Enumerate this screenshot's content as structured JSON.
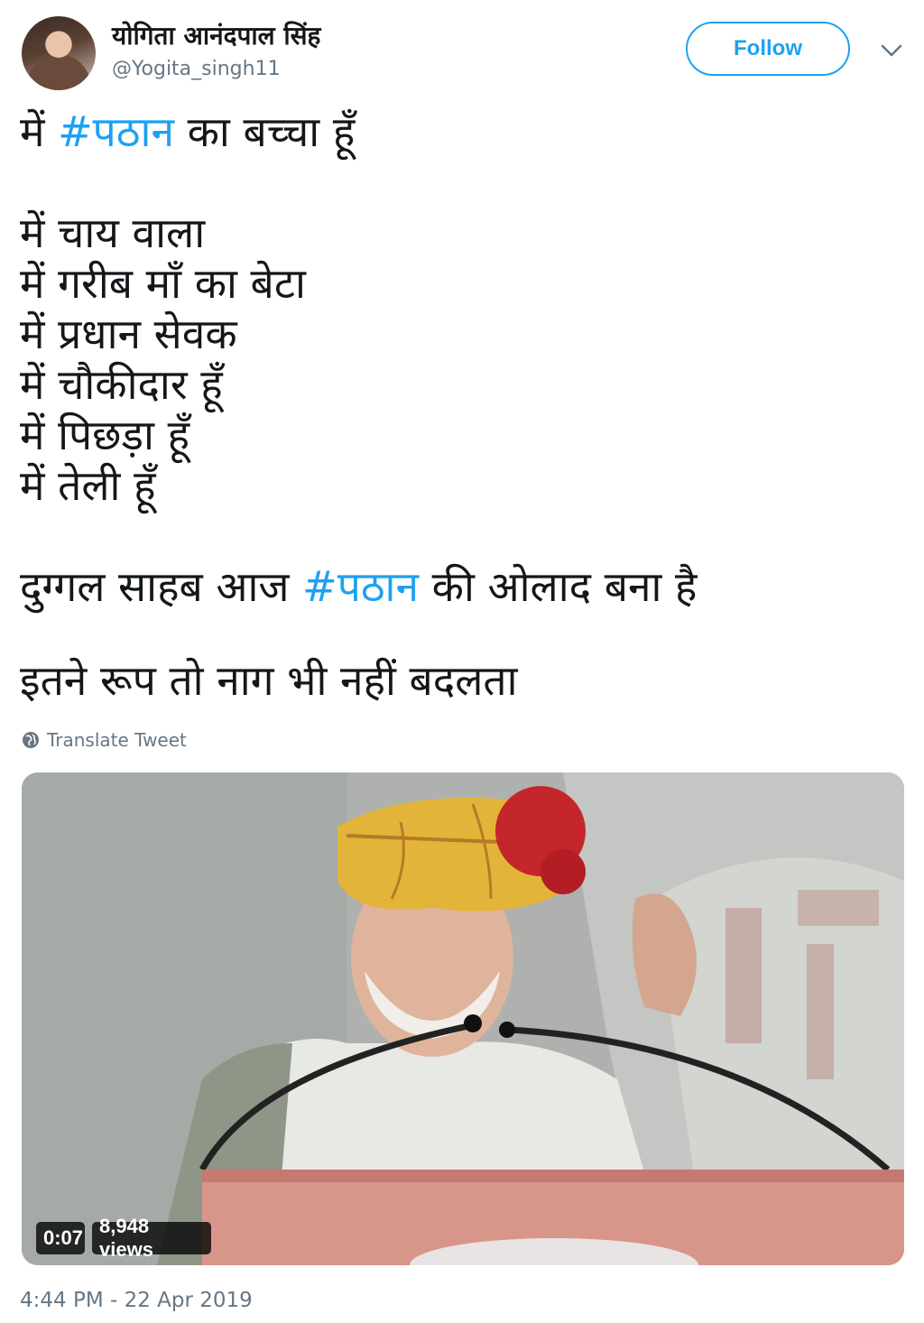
{
  "user": {
    "display_name": "योगिता आनंदपाल सिंह",
    "handle": "@Yogita_singh11",
    "follow_label": "Follow"
  },
  "tweet": {
    "line1_pre": "में ",
    "line1_tag": "#पठान",
    "line1_post": " का बच्चा हूँ",
    "lines": [
      "में चाय वाला",
      "में गरीब माँ का बेटा",
      "में प्रधान सेवक",
      "में चौकीदार हूँ",
      "में पिछड़ा हूँ",
      "में तेली हूँ"
    ],
    "line8_pre": "दुग्गल साहब आज ",
    "line8_tag": "#पठान",
    "line8_post": " की ओलाद बना है",
    "line9": "इतने रूप तो नाग भी नहीं बदलता",
    "translate_label": "Translate Tweet"
  },
  "video": {
    "duration": "0:07",
    "views": "8,948 views"
  },
  "timestamp": "4:44 PM - 22 Apr 2019",
  "colors": {
    "accent": "#1da1f2",
    "secondary_text": "#657786",
    "primary_text": "#14171a"
  }
}
